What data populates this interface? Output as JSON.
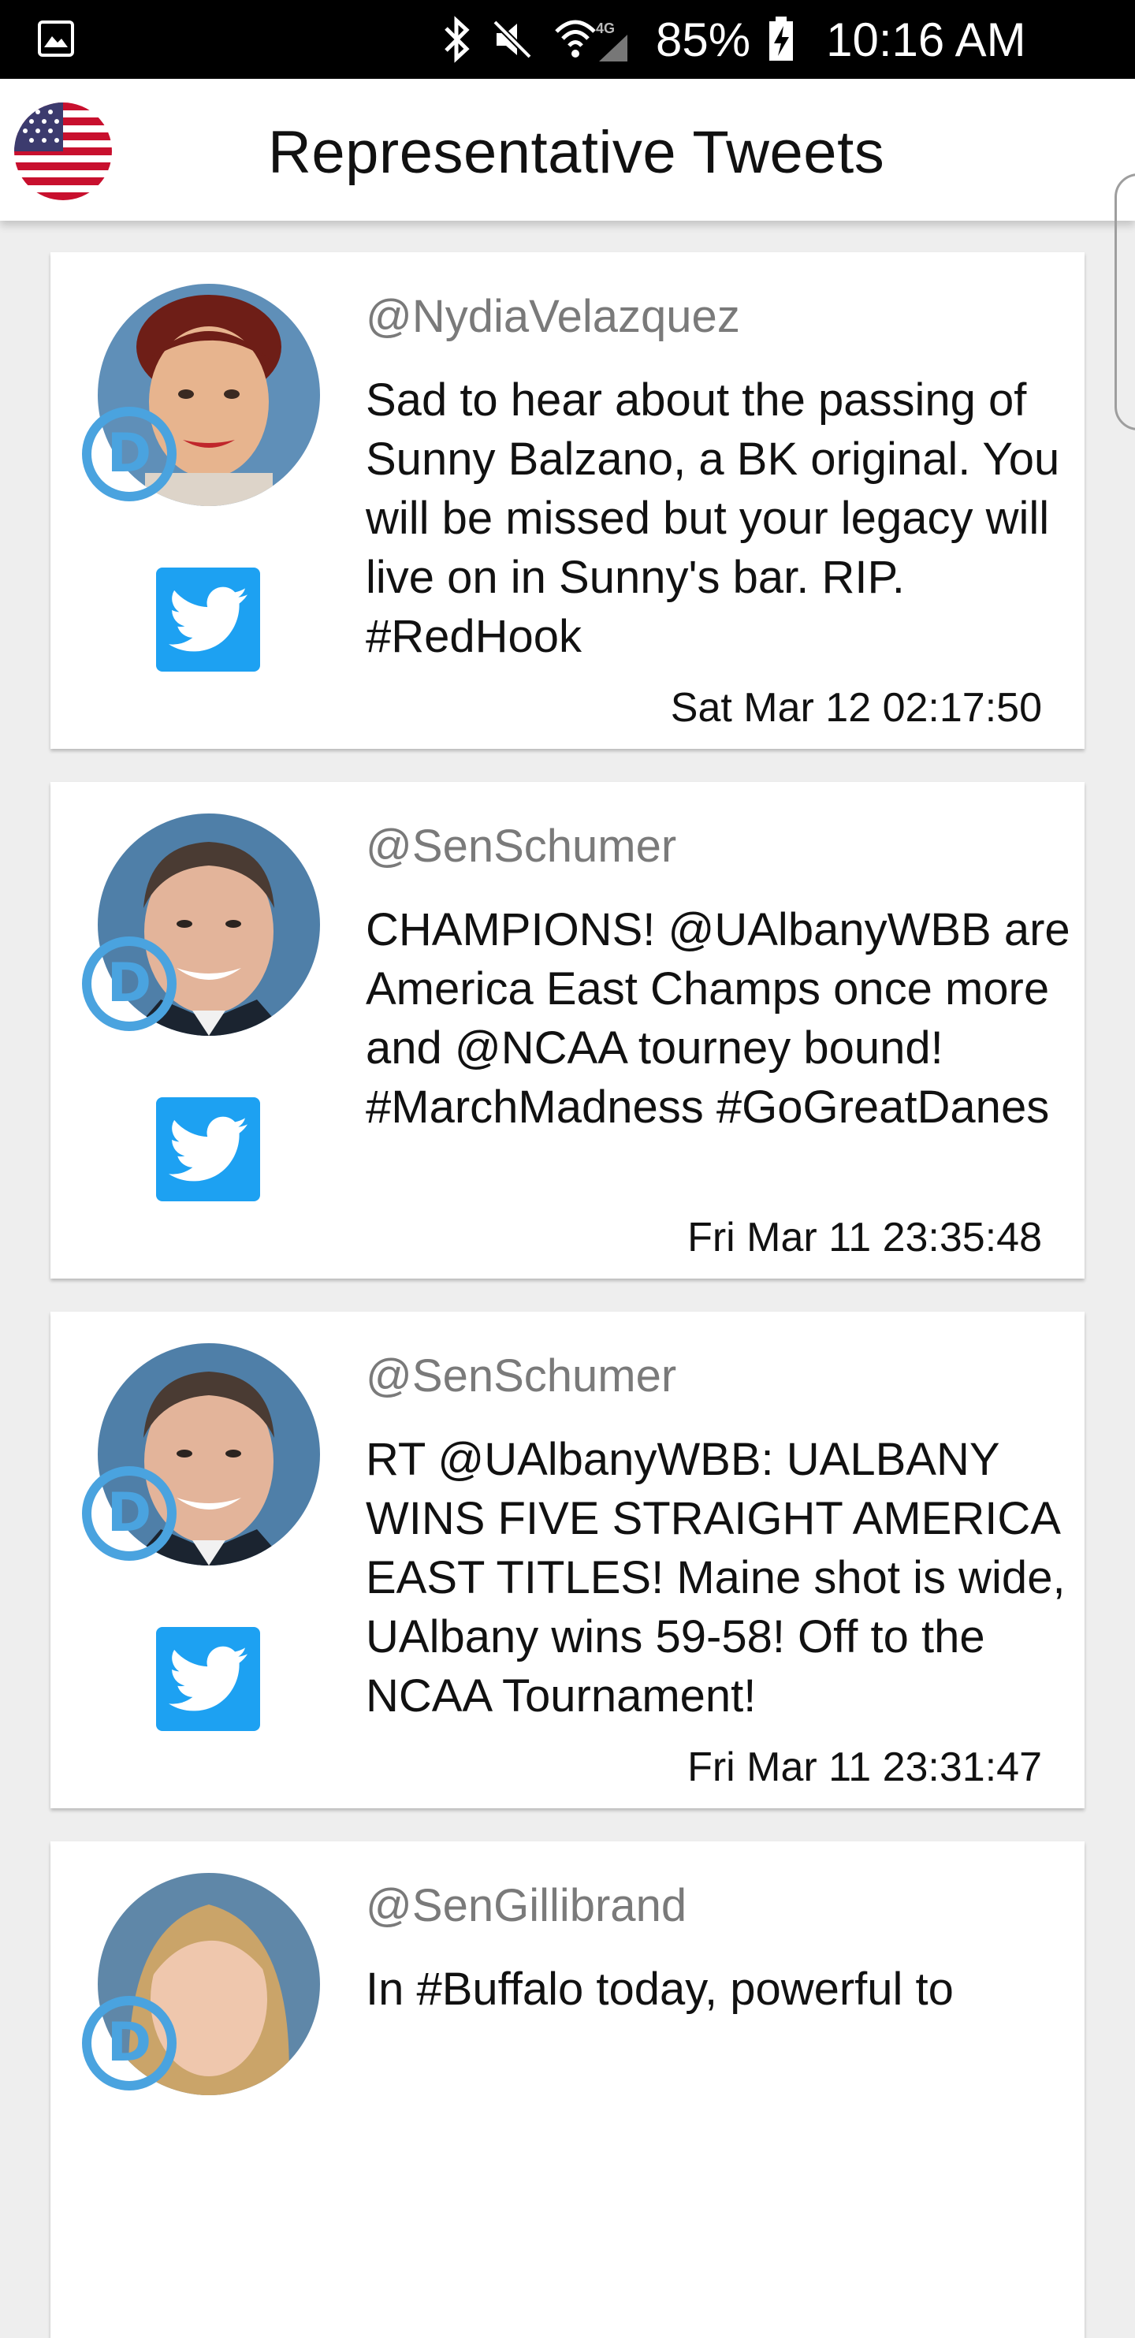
{
  "status_bar": {
    "battery_percent": "85%",
    "time": "10:16 AM",
    "network_label": "4G",
    "icons": [
      "gallery-icon",
      "bluetooth-icon",
      "mute-icon",
      "wifi-icon",
      "signal-icon",
      "battery-charging-icon"
    ]
  },
  "app_bar": {
    "title": "Representative Tweets",
    "logo_icon": "us-flag-icon"
  },
  "colors": {
    "accent": "#1da1f2",
    "party_badge": "#4aa3df",
    "background": "#eeeeee"
  },
  "tweets": [
    {
      "handle": "@NydiaVelazquez",
      "text": "Sad to hear about the passing of Sunny Balzano, a BK original. You will be missed but your legacy will live on in Sunny's bar. RIP. #RedHook",
      "time": "Sat Mar 12 02:17:50",
      "party": "D"
    },
    {
      "handle": "@SenSchumer",
      "text": "CHAMPIONS! @UAlbanyWBB are America East Champs once more and @NCAA tourney bound! #MarchMadness #GoGreatDanes",
      "time": "Fri Mar 11 23:35:48",
      "party": "D"
    },
    {
      "handle": "@SenSchumer",
      "text": "RT @UAlbanyWBB: UALBANY WINS FIVE STRAIGHT AMERICA EAST TITLES! Maine shot is wide, UAlbany wins 59-58! Off to the NCAA Tournament!",
      "time": "Fri Mar 11 23:31:47",
      "party": "D"
    },
    {
      "handle": "@SenGillibrand",
      "text": "In #Buffalo today, powerful to",
      "time": "",
      "party": "D"
    }
  ]
}
